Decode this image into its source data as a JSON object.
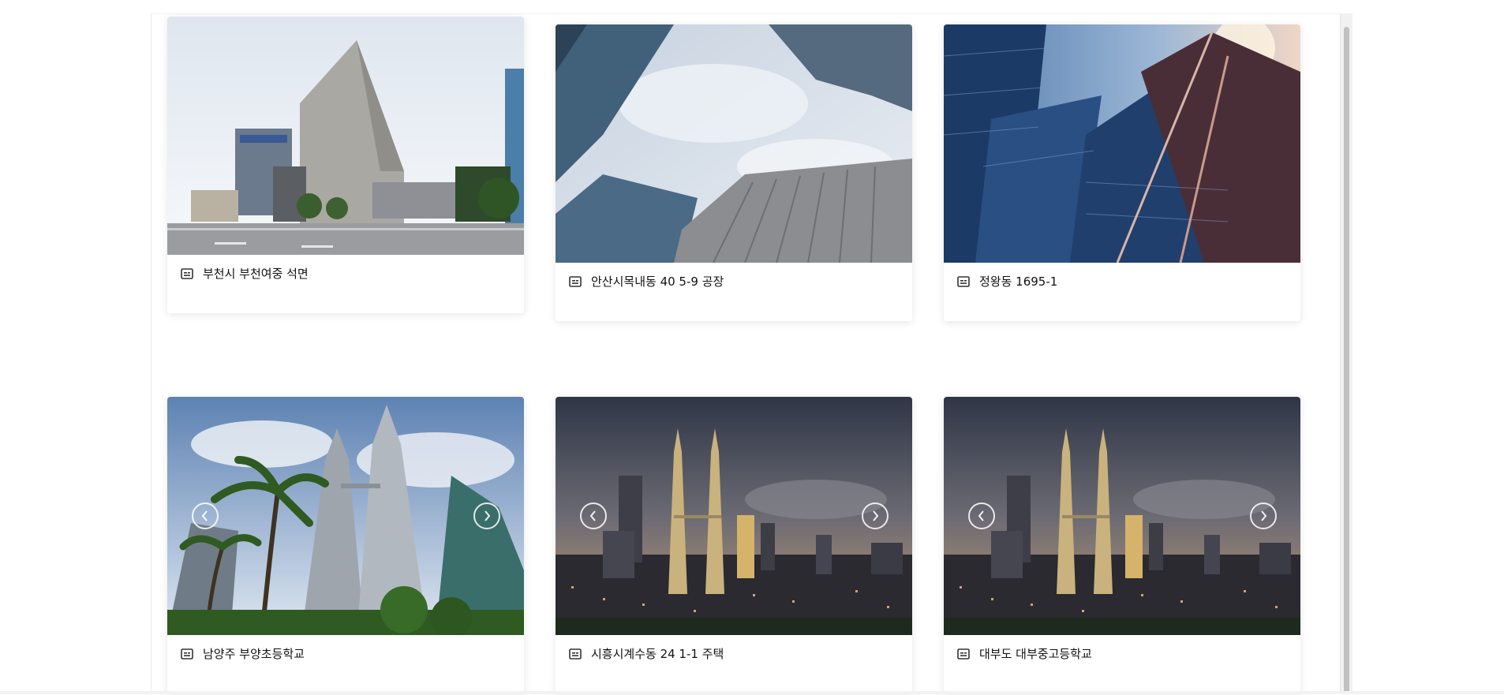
{
  "cards": [
    {
      "title": "부천시 부천여중 석면",
      "image": "building-street-photo"
    },
    {
      "title": "안산시목내동 40 5-9 공장",
      "image": "skyscrapers-looking-up-photo"
    },
    {
      "title": "정왕동 1695-1",
      "image": "glass-towers-sky-photo"
    },
    {
      "title": "남양주 부양초등학교",
      "image": "petronas-towers-palms-photo"
    },
    {
      "title": "시흥시계수동 24 1-1 주택",
      "image": "city-skyline-dusk-photo"
    },
    {
      "title": "대부도 대부중고등학교",
      "image": "city-skyline-dusk-photo"
    }
  ],
  "icons": {
    "caption": "id-card-icon",
    "prev": "chevron-left-circle-icon",
    "next": "chevron-right-circle-icon"
  },
  "colors": {
    "caption_text": "#111111",
    "scroll_thumb": "#c1c1c1"
  }
}
